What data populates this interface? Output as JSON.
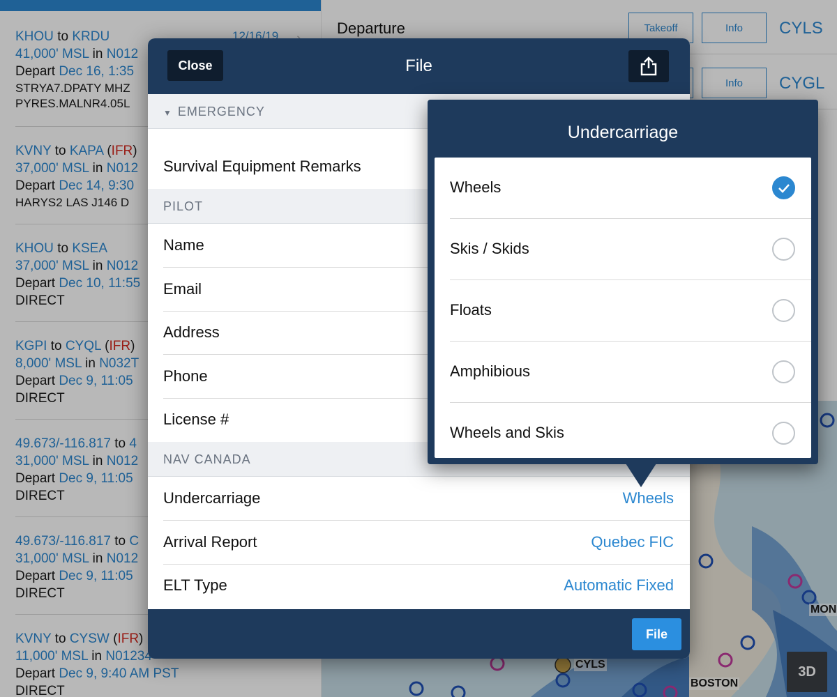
{
  "flights": [
    {
      "from": "KHOU",
      "to": "KRDU",
      "connector": "to",
      "rules": "",
      "date": "12/16/19",
      "altitude": "41,000' MSL",
      "in": "in",
      "aircraft": "N012",
      "depart_label": "Depart",
      "depart_time": "Dec 16, 1:35",
      "route": "STRYA7.DPATY MHZ",
      "route2": "PYRES.MALNR4.05L"
    },
    {
      "from": "KVNY",
      "to": "KAPA",
      "connector": "to",
      "rules": "IFR",
      "date": "",
      "altitude": "37,000' MSL",
      "in": "in",
      "aircraft": "N012",
      "depart_label": "Depart",
      "depart_time": "Dec 14, 9:30",
      "route": "HARYS2 LAS J146 D",
      "route2": ""
    },
    {
      "from": "KHOU",
      "to": "KSEA",
      "connector": "to",
      "rules": "",
      "date": "",
      "altitude": "37,000' MSL",
      "in": "in",
      "aircraft": "N012",
      "depart_label": "Depart",
      "depart_time": "Dec 10, 11:55",
      "route": "DIRECT",
      "route2": ""
    },
    {
      "from": "KGPI",
      "to": "CYQL",
      "connector": "to",
      "rules": "IFR",
      "date": "",
      "altitude": "8,000' MSL",
      "in": "in",
      "aircraft": "N032T",
      "depart_label": "Depart",
      "depart_time": "Dec 9, 11:05",
      "route": "DIRECT",
      "route2": ""
    },
    {
      "from": "49.673/-116.817",
      "to": "4",
      "connector": "to",
      "rules": "",
      "date": "",
      "altitude": "31,000' MSL",
      "in": "in",
      "aircraft": "N012",
      "depart_label": "Depart",
      "depart_time": "Dec 9, 11:05",
      "route": "DIRECT",
      "route2": ""
    },
    {
      "from": "49.673/-116.817",
      "to": "C",
      "connector": "to",
      "rules": "",
      "date": "",
      "altitude": "31,000' MSL",
      "in": "in",
      "aircraft": "N012",
      "depart_label": "Depart",
      "depart_time": "Dec 9, 11:05",
      "route": "DIRECT",
      "route2": ""
    },
    {
      "from": "KVNY",
      "to": "CYSW",
      "connector": "to",
      "rules": "IFR",
      "date": "",
      "altitude": "11,000' MSL",
      "in": "in",
      "aircraft": "N01234",
      "depart_label": "Depart",
      "depart_time": "Dec 9, 9:40 AM PST",
      "route": "DIRECT",
      "route2": ""
    }
  ],
  "departure_panel": {
    "rows": [
      {
        "label": "Departure",
        "takeoff_label": "Takeoff",
        "info_label": "Info",
        "code": "CYLS"
      },
      {
        "label": "",
        "takeoff_label": "",
        "info_label": "Info",
        "code": "CYGL"
      }
    ]
  },
  "map": {
    "labels": [
      "CYLS",
      "BOSTON",
      "MON"
    ],
    "btn_3d": "3D"
  },
  "file_modal": {
    "title": "File",
    "close_label": "Close",
    "share_icon": "share-icon",
    "file_button_label": "File",
    "emergency_section": {
      "label": "EMERGENCY",
      "collapse_icon": "▼"
    },
    "survival_row": {
      "label": "Survival Equipment Remarks"
    },
    "pilot_section": {
      "label": "PILOT"
    },
    "pilot_rows": [
      {
        "label": "Name"
      },
      {
        "label": "Email"
      },
      {
        "label": "Address"
      },
      {
        "label": "Phone"
      },
      {
        "label": "License #"
      }
    ],
    "nav_canada_section": {
      "label": "NAV CANADA"
    },
    "nav_canada_rows": [
      {
        "label": "Undercarriage",
        "value": "Wheels"
      },
      {
        "label": "Arrival Report",
        "value": "Quebec FIC"
      },
      {
        "label": "ELT Type",
        "value": "Automatic Fixed"
      }
    ]
  },
  "undercarriage_popover": {
    "title": "Undercarriage",
    "options": [
      {
        "label": "Wheels",
        "selected": true
      },
      {
        "label": "Skis / Skids",
        "selected": false
      },
      {
        "label": "Floats",
        "selected": false
      },
      {
        "label": "Amphibious",
        "selected": false
      },
      {
        "label": "Wheels and Skis",
        "selected": false
      }
    ]
  },
  "colors": {
    "accent": "#2b87d0",
    "header": "#1e3a5c",
    "ifr_red": "#d4261c",
    "selected_check": "#2b87d0"
  }
}
